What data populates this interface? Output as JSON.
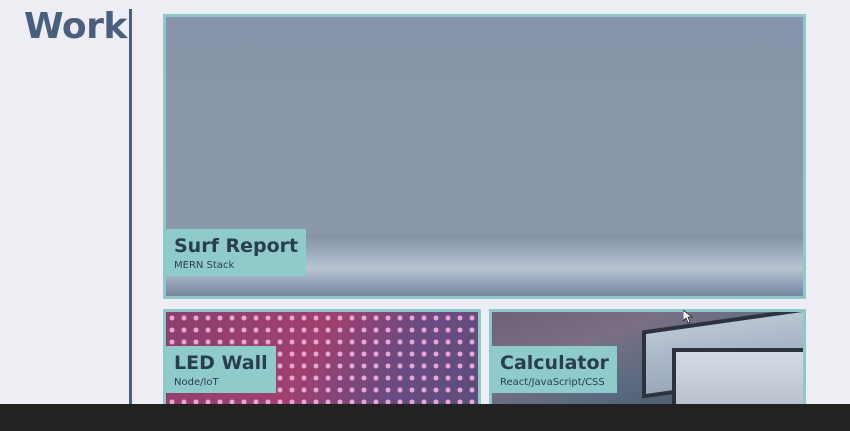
{
  "header": {
    "title": "Work"
  },
  "projects": [
    {
      "title": "Surf Report",
      "subtitle": "MERN Stack"
    },
    {
      "title": "LED Wall",
      "subtitle": "Node/IoT"
    },
    {
      "title": "Calculator",
      "subtitle": "React/JavaScript/CSS"
    }
  ],
  "colors": {
    "accent": "#8fcbca",
    "heading": "#4a5f7e",
    "background": "#eceef4",
    "taskbar": "#222222"
  },
  "icons": {
    "cursor": "mouse-pointer-icon"
  }
}
